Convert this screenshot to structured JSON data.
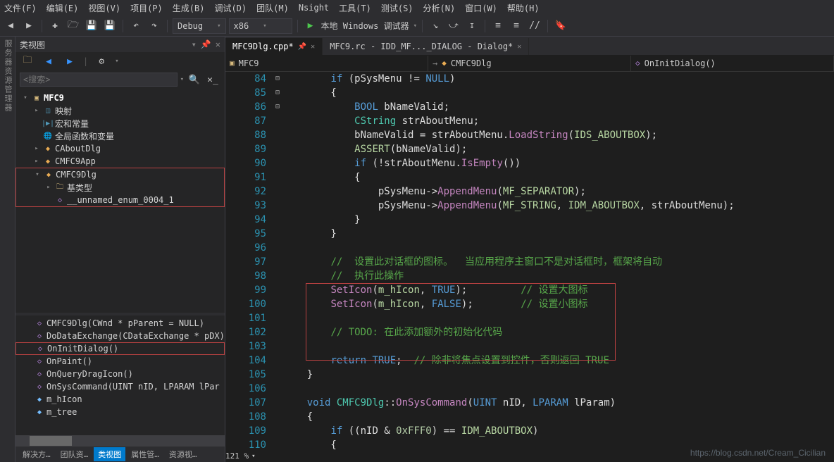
{
  "menu": [
    "文件(F)",
    "编辑(E)",
    "视图(V)",
    "项目(P)",
    "生成(B)",
    "调试(D)",
    "团队(M)",
    "Nsight",
    "工具(T)",
    "测试(S)",
    "分析(N)",
    "窗口(W)",
    "帮助(H)"
  ],
  "config": {
    "build": "Debug",
    "platform": "x86",
    "run": "本地 Windows 调试器"
  },
  "classview": {
    "title": "类视图",
    "search_placeholder": "<搜索>",
    "tree": [
      {
        "depth": 0,
        "exp": "▾",
        "ico": "proj",
        "glyph": "▣",
        "label": "MFC9",
        "bold": true
      },
      {
        "depth": 1,
        "exp": "▸",
        "ico": "map",
        "glyph": "◫",
        "label": "映射"
      },
      {
        "depth": 1,
        "exp": "",
        "ico": "map",
        "glyph": "|▶|",
        "label": "宏和常量"
      },
      {
        "depth": 1,
        "exp": "",
        "ico": "fold",
        "glyph": "🌐",
        "label": "全局函数和变量"
      },
      {
        "depth": 1,
        "exp": "▸",
        "ico": "cls",
        "glyph": "◆",
        "label": "CAboutDlg"
      },
      {
        "depth": 1,
        "exp": "▸",
        "ico": "cls",
        "glyph": "◆",
        "label": "CMFC9App"
      },
      {
        "depth": 1,
        "exp": "▾",
        "ico": "cls",
        "glyph": "◆",
        "label": "CMFC9Dlg",
        "boxstart": true
      },
      {
        "depth": 2,
        "exp": "▸",
        "ico": "fold",
        "glyph": "🗀",
        "label": "基类型"
      },
      {
        "depth": 2,
        "exp": "",
        "ico": "enum",
        "glyph": "◇",
        "label": "__unnamed_enum_0004_1",
        "boxend": true
      }
    ],
    "members": [
      {
        "ico": "func",
        "glyph": "◇",
        "label": "CMFC9Dlg(CWnd * pParent = NULL)"
      },
      {
        "ico": "func",
        "glyph": "◇",
        "label": "DoDataExchange(CDataExchange * pDX)"
      },
      {
        "ico": "func",
        "glyph": "◇",
        "label": "OnInitDialog()",
        "boxed": true
      },
      {
        "ico": "func",
        "glyph": "◇",
        "label": "OnPaint()"
      },
      {
        "ico": "func",
        "glyph": "◇",
        "label": "OnQueryDragIcon()"
      },
      {
        "ico": "func",
        "glyph": "◇",
        "label": "OnSysCommand(UINT nID, LPARAM lPar"
      },
      {
        "ico": "var",
        "glyph": "◆",
        "label": "m_hIcon"
      },
      {
        "ico": "var",
        "glyph": "◆",
        "label": "m_tree"
      }
    ],
    "bottom_tabs": [
      "解决方…",
      "团队资…",
      "类视图",
      "属性管…",
      "资源视…"
    ],
    "bottom_active": 2
  },
  "editor": {
    "tabs": [
      {
        "label": "MFC9Dlg.cpp*",
        "active": true,
        "pinned": true
      },
      {
        "label": "MFC9.rc - IDD_MF..._DIALOG - Dialog*",
        "active": false
      }
    ],
    "crumbs": [
      "MFC9",
      "CMFC9Dlg",
      "OnInitDialog()"
    ],
    "first_line": 84,
    "lines": [
      {
        "f": "",
        "html": "        <span class='kw'>if</span> (pSysMenu != <span class='kw'>NULL</span>)"
      },
      {
        "f": "",
        "html": "        {"
      },
      {
        "f": "",
        "html": "            <span class='kw'>BOOL</span> bNameValid;"
      },
      {
        "f": "",
        "html": "            <span class='type'>CString</span> strAboutMenu;"
      },
      {
        "f": "",
        "html": "            bNameValid = strAboutMenu.<span class='fn'>LoadString</span>(<span class='mac'>IDS_ABOUTBOX</span>);"
      },
      {
        "f": "",
        "html": "            <span class='mac'>ASSERT</span>(bNameValid);"
      },
      {
        "f": "⊟",
        "html": "            <span class='kw'>if</span> (!strAboutMenu.<span class='fn'>IsEmpty</span>())"
      },
      {
        "f": "",
        "html": "            {"
      },
      {
        "f": "",
        "html": "                pSysMenu-&gt;<span class='fn'>AppendMenu</span>(<span class='mac'>MF_SEPARATOR</span>);"
      },
      {
        "f": "",
        "html": "                pSysMenu-&gt;<span class='fn'>AppendMenu</span>(<span class='mac'>MF_STRING</span>, <span class='mac'>IDM_ABOUTBOX</span>, strAboutMenu);"
      },
      {
        "f": "",
        "html": "            }"
      },
      {
        "f": "",
        "html": "        }"
      },
      {
        "f": "",
        "html": ""
      },
      {
        "f": "",
        "html": "        <span class='cmt'>//  设置此对话框的图标。  当应用程序主窗口不是对话框时，框架将自动</span>"
      },
      {
        "f": "",
        "html": "        <span class='cmt'>//  执行此操作</span>"
      },
      {
        "f": "",
        "html": "        <span class='fn'>SetIcon</span>(<span class='mac'>m_hIcon</span>, <span class='kw'>TRUE</span>);         <span class='cmt'>// 设置大图标</span>"
      },
      {
        "f": "",
        "html": "        <span class='fn'>SetIcon</span>(<span class='mac'>m_hIcon</span>, <span class='kw'>FALSE</span>);        <span class='cmt'>// 设置小图标</span>"
      },
      {
        "f": "",
        "html": ""
      },
      {
        "f": "",
        "html": "        <span class='cmt'>// TODO: 在此添加额外的初始化代码</span>"
      },
      {
        "f": "",
        "html": ""
      },
      {
        "f": "",
        "html": "        <span class='kw'>return</span> <span class='kw'>TRUE</span>;  <span class='cmt'>// 除非将焦点设置到控件，否则返回 TRUE</span>"
      },
      {
        "f": "",
        "html": "    }"
      },
      {
        "f": "",
        "html": ""
      },
      {
        "f": "⊟",
        "html": "    <span class='kw'>void</span> <span class='type'>CMFC9Dlg</span>::<span class='fn'>OnSysCommand</span>(<span class='kw'>UINT</span> nID, <span class='kw'>LPARAM</span> lParam)"
      },
      {
        "f": "",
        "html": "    {"
      },
      {
        "f": "⊟",
        "html": "        <span class='kw'>if</span> ((nID &amp; <span class='num'>0xFFF0</span>) == <span class='mac'>IDM_ABOUTBOX</span>)"
      },
      {
        "f": "",
        "html": "        {"
      }
    ]
  },
  "zoom": "121 %",
  "watermark": "https://blog.csdn.net/Cream_Cicilian"
}
